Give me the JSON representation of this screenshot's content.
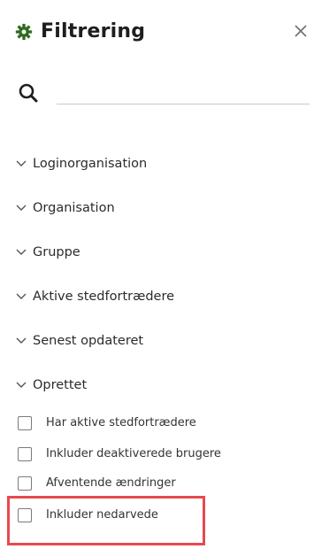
{
  "header": {
    "title": "Filtrering",
    "gear_icon": "gear-icon",
    "close_icon": "close-icon",
    "close_glyph": "×"
  },
  "search": {
    "icon": "search-icon",
    "value": "",
    "placeholder": ""
  },
  "sections": [
    {
      "label": "Loginorganisation",
      "state": "collapsed"
    },
    {
      "label": "Organisation",
      "state": "collapsed"
    },
    {
      "label": "Gruppe",
      "state": "collapsed"
    },
    {
      "label": "Aktive stedfortrædere",
      "state": "collapsed"
    },
    {
      "label": "Senest opdateret",
      "state": "collapsed"
    },
    {
      "label": "Oprettet",
      "state": "collapsed"
    }
  ],
  "checkboxes": [
    {
      "label": "Har aktive stedfortrædere",
      "checked": false
    },
    {
      "label": "Inkluder deaktiverede brugere",
      "checked": false
    },
    {
      "label": "Afventende ændringer",
      "checked": false
    },
    {
      "label": "Inkluder nedarvede",
      "checked": false
    }
  ],
  "colors": {
    "accent": "#2f6b1f",
    "highlight": "#e8494f",
    "text": "#2b2b2b",
    "divider": "#c9c9c9"
  }
}
